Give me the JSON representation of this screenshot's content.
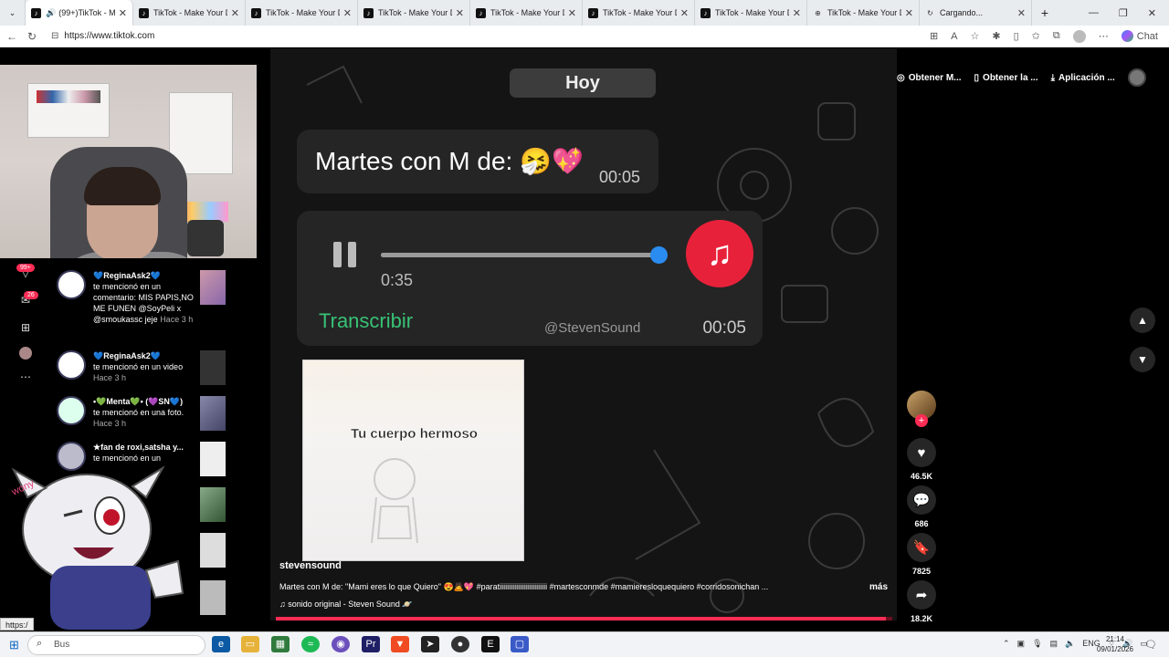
{
  "browser": {
    "tabs": [
      {
        "label": "(99+)TikTok - Make",
        "active": true
      },
      {
        "label": "TikTok - Make Your Day"
      },
      {
        "label": "TikTok - Make Your Day"
      },
      {
        "label": "TikTok - Make Your Day"
      },
      {
        "label": "TikTok - Make Your Day"
      },
      {
        "label": "TikTok - Make Your Day"
      },
      {
        "label": "TikTok - Make Your Day"
      },
      {
        "label": "TikTok - Make Your Day"
      },
      {
        "label": "Cargando..."
      }
    ],
    "url": "https://www.tiktok.com",
    "chat_label": "Chat"
  },
  "rail": {
    "badge_notifications": "99+",
    "badge_messages": "26"
  },
  "notifications": [
    {
      "name": "💙ReginaAsk2💙",
      "text": "te mencionó en un comentario: MIS PAPIS,NO ME FUNEN @SoyPeli x @smoukassc jeje",
      "time": "Hace 3 h"
    },
    {
      "name": "💙ReginaAsk2💙",
      "text": "te mencionó en un video",
      "time": "Hace 3 h"
    },
    {
      "name": "•💚Menta💚• (💜SN💙)",
      "text": "te mencionó en una foto.",
      "time": "Hace 3 h"
    },
    {
      "name": "★fan de roxi,satsha y...",
      "text": "te mencionó en un",
      "time": ""
    }
  ],
  "topbar": {
    "get_coins": "Obtener M...",
    "get_app": "Obtener la ...",
    "app": "Aplicación ..."
  },
  "video": {
    "date_chip": "Hoy",
    "message": "Martes con M de: 🤧💖",
    "message_time": "00:05",
    "audio_current": "0:35",
    "audio_progress": 0.98,
    "transcribe": "Transcribir",
    "audio_handle": "@StevenSound",
    "audio_duration": "00:05",
    "clip_text": "Tu cuerpo hermoso",
    "author": "stevensound",
    "caption": "Martes con M de: \"Mami eres lo que Quiero\" 😍🙇💖 #paratiiiiiiiiiiiiiiiiiiiiiiiiii #martesconmde #mamieresloquequiero #corridosonichan ...",
    "more": "más",
    "sound": "sonido original - Steven Sound 🪐",
    "progress": 0.99
  },
  "actions": {
    "likes": "46.5K",
    "comments": "686",
    "saves": "7825",
    "shares": "18.2K"
  },
  "taskbar": {
    "search_placeholder": "Bus",
    "time": "21:14",
    "date": "09/01/2026",
    "lang": "ENG"
  },
  "status_url": "https:/"
}
